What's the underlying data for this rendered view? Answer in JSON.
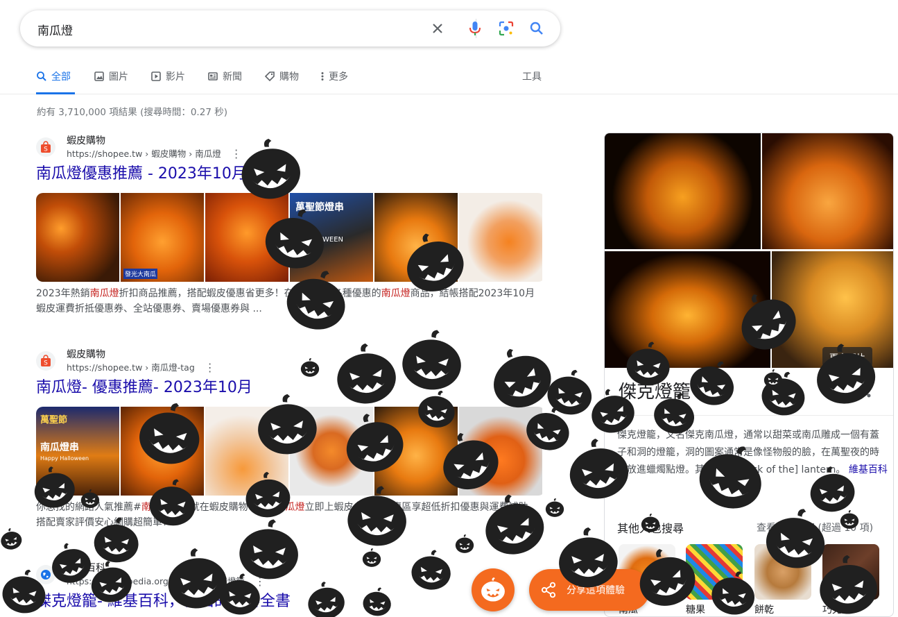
{
  "search": {
    "query": "南瓜燈"
  },
  "icons": [
    "close-icon",
    "mic-icon",
    "lens-icon",
    "search-icon",
    "image-icon",
    "video-icon",
    "news-icon",
    "tag-icon",
    "more-icon",
    "share-icon",
    "pumpkin-icon"
  ],
  "tabs": [
    {
      "label": "全部",
      "active": true
    },
    {
      "label": "圖片"
    },
    {
      "label": "影片"
    },
    {
      "label": "新聞"
    },
    {
      "label": "購物"
    },
    {
      "label": "更多"
    }
  ],
  "tools_label": "工具",
  "stats": "約有 3,710,000 項結果 (搜尋時間：0.27 秒)",
  "results": [
    {
      "site": "蝦皮購物",
      "url": "https://shopee.tw › 蝦皮購物 › 南瓜燈",
      "title": "南瓜燈優惠推薦 - 2023年10月",
      "snippet_1": "2023年熱銷",
      "snippet_em_1": "南瓜燈",
      "snippet_2": "折扣商品推薦，搭配蝦皮優惠省更多！",
      "snippet_3": "在蝦皮購買各種優惠的",
      "snippet_em_2": "南瓜燈",
      "snippet_4": "商品，結帳搭配2023年10月蝦皮運費折抵優惠券、全站優惠券、賣場優惠券與 ..."
    },
    {
      "site": "蝦皮購物",
      "url": "https://shopee.tw › 南瓜燈-tag",
      "title": "南瓜燈- 優惠推薦- 2023年10月",
      "snippet_1": "你想找的網路人氣推薦#",
      "snippet_em_1": "南瓜燈",
      "snippet_2": "商品就在蝦皮購物！買#",
      "snippet_em_2": "南瓜燈",
      "snippet_3": "立即上蝦皮台灣商品專區享超低折扣優惠與運費補助，搭配賣家評價安心網購超簡單！"
    },
    {
      "site": "維基百科",
      "url": "https://zh.wikipedia.org › zh-tw › 傑克燈籠",
      "title": "傑克燈籠- 維基百科，自由的百科全書"
    }
  ],
  "thumb_texts": {
    "t1": "發光大南瓜",
    "t2": "萬聖節燈串",
    "t3": "HALLOWEEN",
    "t4": "萬聖節",
    "t5": "南瓜燈串",
    "t6": "Happy Halloween"
  },
  "knowledge_panel": {
    "more_images": "更多圖片",
    "title": "傑克燈籠",
    "desc_1": "傑克燈籠，又名傑克南瓜燈，通常以甜菜或南瓜雕成一個有蓋子和洞的燈籠，洞的圖案通常是像怪物般的臉，在萬聖夜的時候放進蠟燭點燈。其字源來自jack of the] lantern。",
    "desc_link": "維基百科",
    "also_title": "其他人也搜尋",
    "also_more": "查看更多內容 (超過 10 項)",
    "also": [
      {
        "label": "南瓜"
      },
      {
        "label": "糖果"
      },
      {
        "label": "餅乾"
      },
      {
        "label": "巧克力"
      }
    ]
  },
  "share_label": "分享這項體驗",
  "colors": {
    "accent": "#1a73e8",
    "link": "#1a0dab",
    "emphasis": "#c5221f",
    "orange": "#f46a1f"
  }
}
